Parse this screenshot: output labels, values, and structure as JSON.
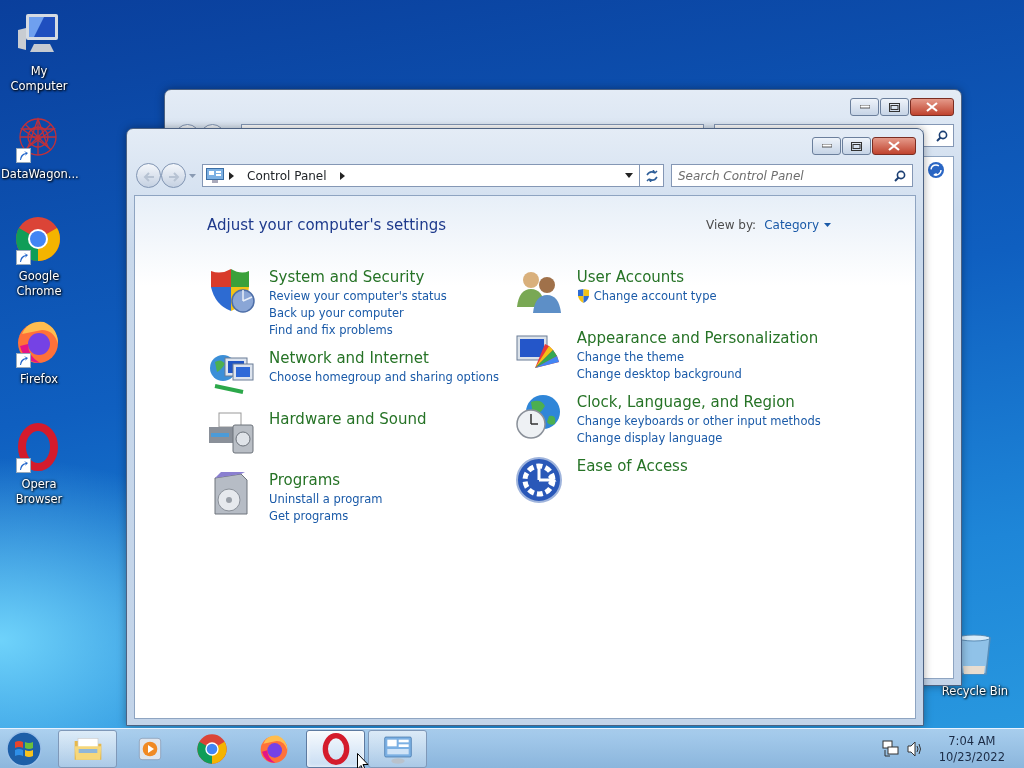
{
  "desktop_icons": [
    {
      "label": "My Computer",
      "kind": "computer",
      "shortcut": false
    },
    {
      "label": "DataWagon...",
      "kind": "datawagon",
      "shortcut": true
    },
    {
      "label": "Google Chrome",
      "kind": "chrome",
      "shortcut": true
    },
    {
      "label": "Firefox",
      "kind": "firefox",
      "shortcut": true
    },
    {
      "label": "Opera Browser",
      "kind": "opera",
      "shortcut": true
    },
    {
      "label": "Recycle Bin",
      "kind": "recycle",
      "shortcut": false
    }
  ],
  "window": {
    "address_bar": {
      "path": [
        "Control Panel"
      ]
    },
    "search": {
      "placeholder": "Search Control Panel"
    },
    "heading": "Adjust your computer's settings",
    "view_by": {
      "label": "View by:",
      "value": "Category"
    },
    "columns": [
      [
        {
          "title": "System and Security",
          "kind": "security",
          "links": [
            {
              "text": "Review your computer's status",
              "shield": false
            },
            {
              "text": "Back up your computer",
              "shield": false
            },
            {
              "text": "Find and fix problems",
              "shield": false
            }
          ]
        },
        {
          "title": "Network and Internet",
          "kind": "network",
          "links": [
            {
              "text": "Choose homegroup and sharing options",
              "shield": false
            }
          ]
        },
        {
          "title": "Hardware and Sound",
          "kind": "hardware"
        },
        {
          "title": "Programs",
          "kind": "programs",
          "links": [
            {
              "text": "Uninstall a program",
              "shield": false
            },
            {
              "text": "Get programs",
              "shield": false
            }
          ]
        }
      ],
      [
        {
          "title": "User Accounts",
          "kind": "users",
          "links": [
            {
              "text": "Change account type",
              "shield": true
            }
          ]
        },
        {
          "title": "Appearance and Personalization",
          "kind": "appearance",
          "links": [
            {
              "text": "Change the theme",
              "shield": false
            },
            {
              "text": "Change desktop background",
              "shield": false
            }
          ]
        },
        {
          "title": "Clock, Language, and Region",
          "kind": "clock",
          "links": [
            {
              "text": "Change keyboards or other input methods",
              "shield": false
            },
            {
              "text": "Change display language",
              "shield": false
            }
          ]
        },
        {
          "title": "Ease of Access",
          "kind": "access"
        }
      ]
    ]
  },
  "taskbar": {
    "items": [
      {
        "kind": "explorer",
        "running": true,
        "highlighted": false
      },
      {
        "kind": "media",
        "running": false,
        "highlighted": false
      },
      {
        "kind": "chrome",
        "running": false,
        "highlighted": false
      },
      {
        "kind": "firefox",
        "running": false,
        "highlighted": false
      },
      {
        "kind": "opera",
        "running": false,
        "highlighted": true
      },
      {
        "kind": "controlpanel",
        "running": true,
        "highlighted": false
      }
    ],
    "clock": {
      "time": "7:04 AM",
      "date": "10/23/2022"
    }
  }
}
